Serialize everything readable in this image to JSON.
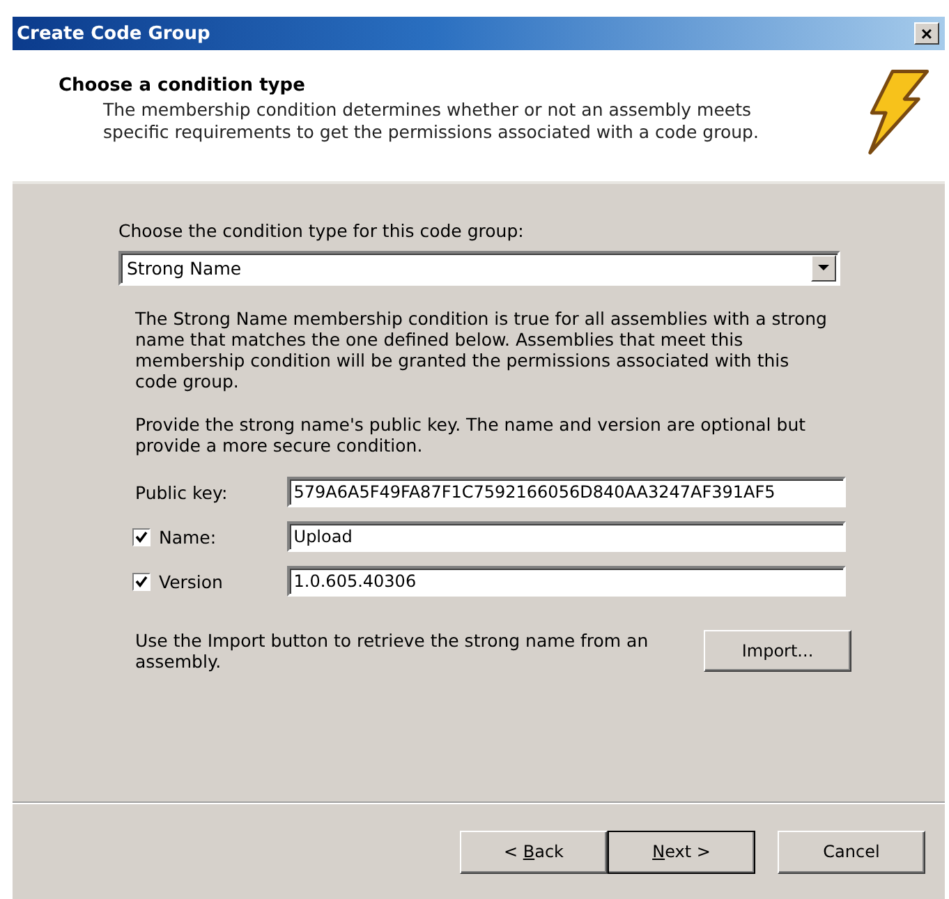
{
  "window": {
    "title": "Create Code Group",
    "close": "×"
  },
  "header": {
    "title": "Choose a condition type",
    "description": "The membership condition determines whether or not an assembly meets specific requirements to get the permissions associated with a code group."
  },
  "condition": {
    "label": "Choose the condition type for this code group:",
    "value": "Strong Name"
  },
  "explanation": "The Strong Name membership condition is true for all assemblies with a strong name that matches the one defined below.  Assemblies that meet this membership condition will be granted the permissions associated with this code group.",
  "instruction": "Provide the strong name's public key.  The name and version are optional but provide a more secure condition.",
  "fields": [
    {
      "kind": "plain",
      "label": "Public key:",
      "value": "579A6A5F49FA87F1C7592166056D840AA3247AF391AF5"
    },
    {
      "kind": "checkbox",
      "label": "Name:",
      "checked": true,
      "value": "Upload"
    },
    {
      "kind": "checkbox",
      "label": "Version",
      "checked": true,
      "value": "1.0.605.40306"
    }
  ],
  "import": {
    "text": "Use the Import button to retrieve the strong name from an assembly.",
    "button": "Import..."
  },
  "buttons": [
    {
      "label": "< ",
      "mnemonic": "B",
      "label_rest": "ack",
      "default": false
    },
    {
      "mnemonic": "N",
      "label_rest": "ext >",
      "default": true
    },
    {
      "label": "Cancel",
      "default": false
    }
  ]
}
